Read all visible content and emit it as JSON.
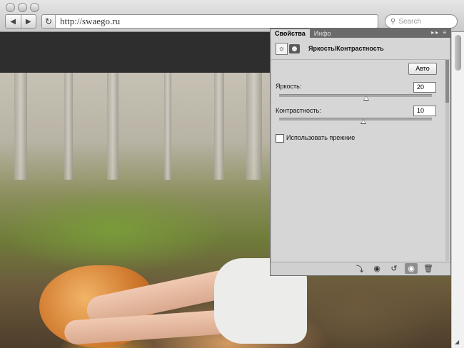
{
  "browser": {
    "url": "http://swaego.ru",
    "search_placeholder": "Search",
    "back_icon": "arrow-left",
    "forward_icon": "arrow-right",
    "reload_icon": "reload"
  },
  "panel": {
    "tabs": [
      "Свойства",
      "Инфо"
    ],
    "title": "Яркость/Контрастность",
    "auto_label": "Авто",
    "brightness": {
      "label": "Яркость:",
      "value": "20",
      "slider_fraction": 0.57
    },
    "contrast": {
      "label": "Контрастность:",
      "value": "10",
      "slider_fraction": 0.55
    },
    "legacy_label": "Использовать прежние",
    "legacy_checked": false
  }
}
